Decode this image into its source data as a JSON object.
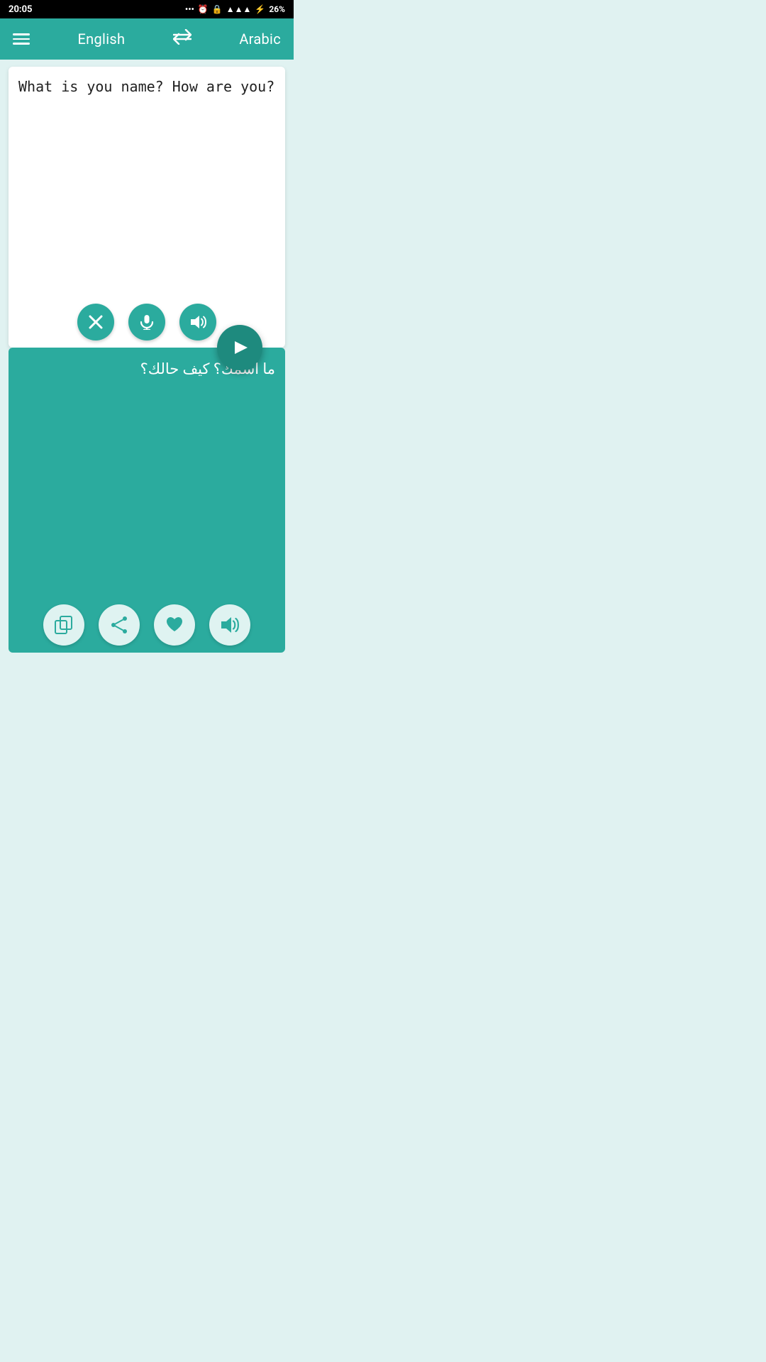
{
  "statusBar": {
    "time": "20:05",
    "rightIcons": "... ⏰ 🔒 📶 ⚡ 26%"
  },
  "toolbar": {
    "menuLabel": "menu",
    "sourceLang": "English",
    "swapLabel": "swap",
    "targetLang": "Arabic"
  },
  "sourcePanel": {
    "inputText": "What is you name? How are you?",
    "clearLabel": "clear",
    "micLabel": "microphone",
    "speakLabel": "speak"
  },
  "fab": {
    "label": "translate"
  },
  "resultPanel": {
    "translatedText": "ما اسمك؟ كيف حالك؟",
    "copyLabel": "copy",
    "shareLabel": "share",
    "favoriteLabel": "favorite",
    "speakLabel": "speak"
  }
}
